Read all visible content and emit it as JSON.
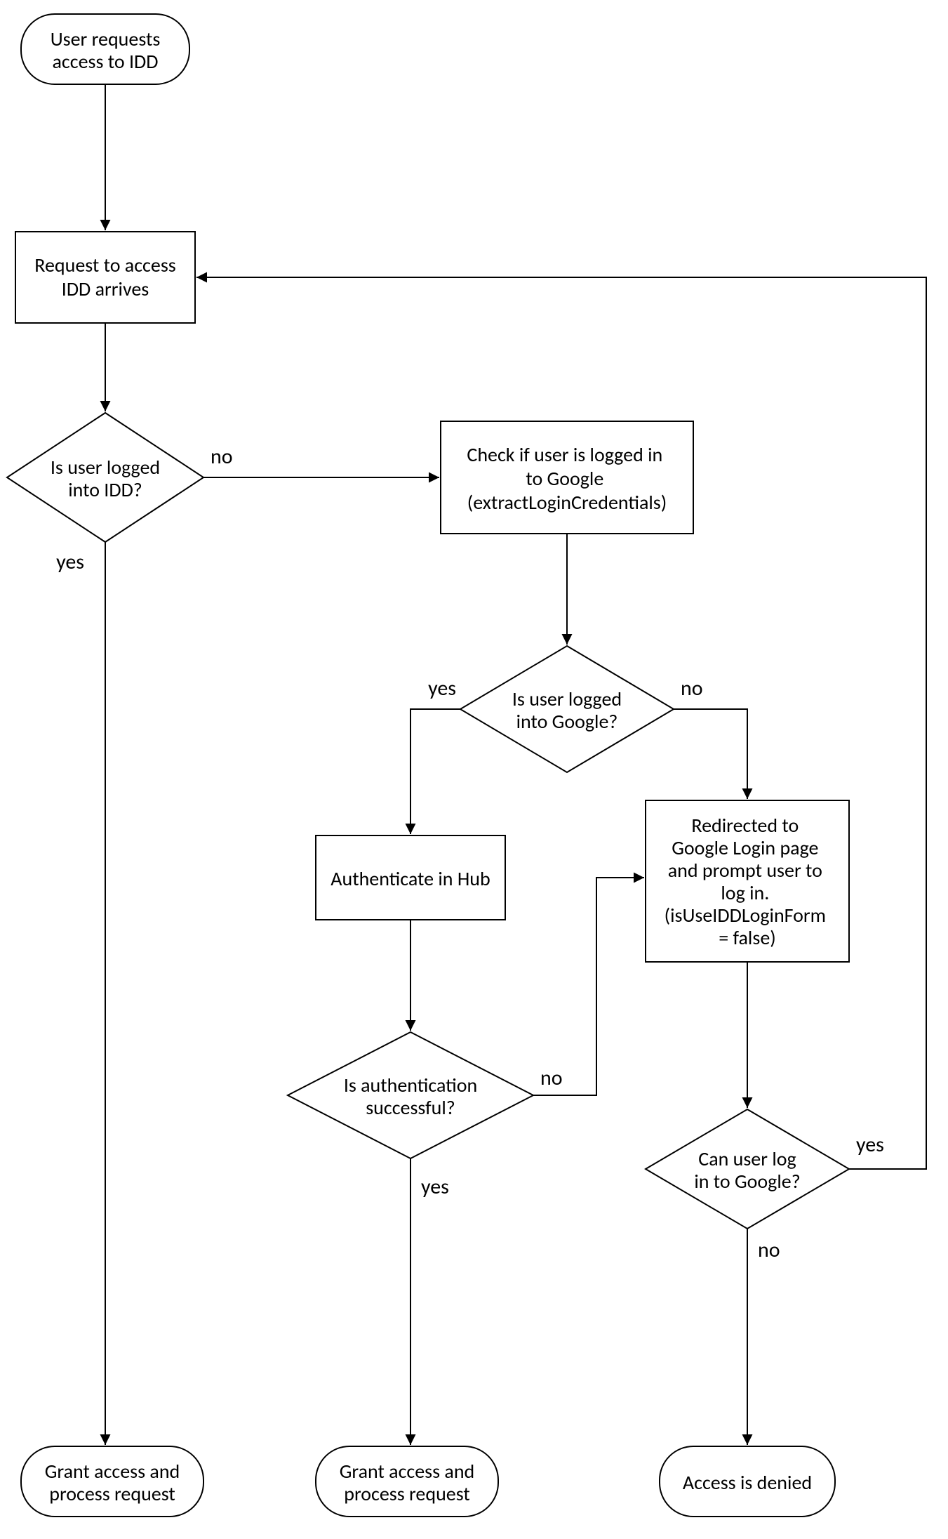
{
  "nodes": {
    "start": {
      "lines": [
        "User requests",
        "access to IDD"
      ]
    },
    "arrive": {
      "lines": [
        "Request to access",
        "IDD arrives"
      ]
    },
    "q_idd": {
      "lines": [
        "Is user logged",
        "into IDD?"
      ]
    },
    "check_google": {
      "lines": [
        "Check if user is logged in",
        "to Google",
        "(extractLoginCredentials)"
      ]
    },
    "q_google": {
      "lines": [
        "Is user logged",
        "into Google?"
      ]
    },
    "auth_hub": {
      "lines": [
        "Authenticate in Hub"
      ]
    },
    "redirect": {
      "lines": [
        "Redirected to",
        "Google Login page",
        "and prompt user to",
        "log in.",
        "(isUseIDDLoginForm",
        "= false)"
      ]
    },
    "q_auth_ok": {
      "lines": [
        "Is authentication",
        "successful?"
      ]
    },
    "q_can_login": {
      "lines": [
        "Can user log",
        "in to Google?"
      ]
    },
    "grant1": {
      "lines": [
        "Grant access and",
        "process request"
      ]
    },
    "grant2": {
      "lines": [
        "Grant access and",
        "process request"
      ]
    },
    "denied": {
      "lines": [
        "Access is denied"
      ]
    }
  },
  "labels": {
    "yes": "yes",
    "no": "no"
  }
}
